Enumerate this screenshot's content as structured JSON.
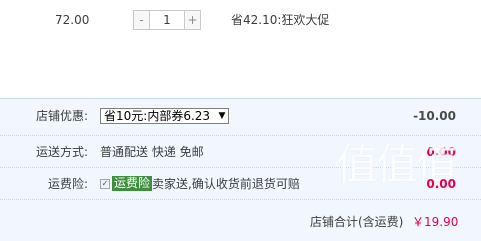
{
  "item": {
    "price": "72.00",
    "quantity": {
      "decrement": "-",
      "value": "1",
      "increment": "+"
    },
    "promo": "省42.10:狂欢大促"
  },
  "order": {
    "shop_discount": {
      "label": "店铺优惠:",
      "selected_option": "省10元:内部券6.23",
      "amount": "-10.00"
    },
    "shipping": {
      "label": "运送方式:",
      "value": "普通配送 快递 免邮",
      "amount": "0.00"
    },
    "freight_insurance": {
      "label": "运费险:",
      "checked": true,
      "tag": "运费险",
      "description": "卖家送,确认收货前退货可赔",
      "amount": "0.00"
    },
    "total": {
      "label": "店铺合计(含运费)",
      "value": "￥19.90"
    }
  },
  "watermark": "值值值",
  "colors": {
    "section_bg": "#f2f7ff",
    "amount_red": "#e4004f",
    "insurance_tag": "#3f8f3f"
  }
}
